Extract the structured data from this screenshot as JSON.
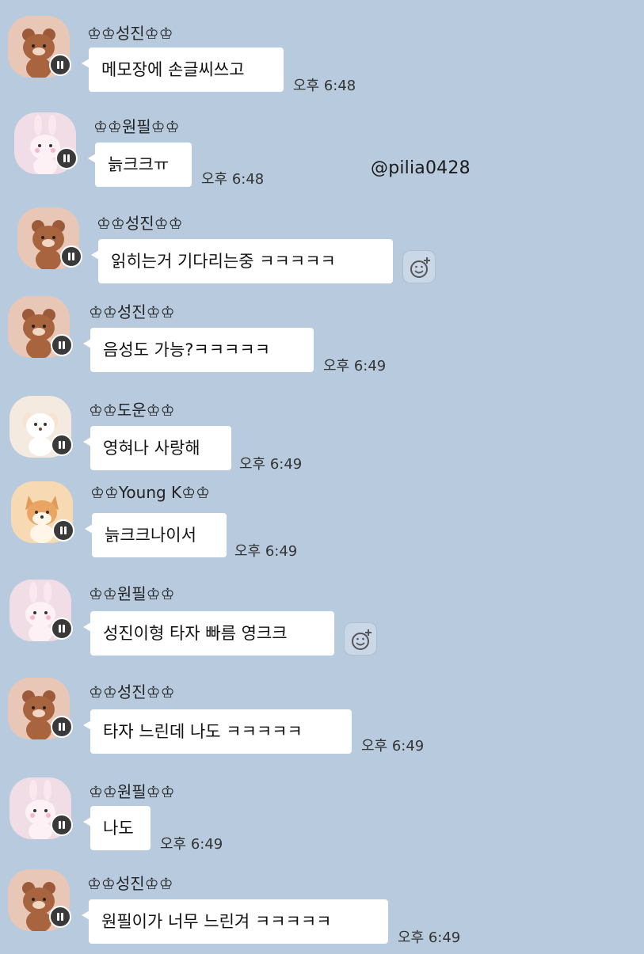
{
  "watermark": "@pilia0428",
  "colors": {
    "background": "#b8cadd",
    "bubble": "#ffffff"
  },
  "messages": [
    {
      "sender": "♔♔성진♔♔",
      "text": "메모장에 손글씨쓰고",
      "time": "오후 6:48",
      "avatar": "bear"
    },
    {
      "sender": "♔♔원필♔♔",
      "text": "늙크크ㅠ",
      "time": "오후 6:48",
      "avatar": "bunny"
    },
    {
      "sender": "♔♔성진♔♔",
      "text": "읽히는거 기다리는중 ㅋㅋㅋㅋㅋ",
      "time": "",
      "avatar": "bear",
      "reaction": "add-reaction-icon"
    },
    {
      "sender": "♔♔성진♔♔",
      "text": "음성도 가능?ㅋㅋㅋㅋㅋ",
      "time": "오후 6:49",
      "avatar": "bear"
    },
    {
      "sender": "♔♔도운♔♔",
      "text": "영혀나 사랑해",
      "time": "오후 6:49",
      "avatar": "puppy"
    },
    {
      "sender": "♔♔Young K♔♔",
      "text": "늙크크나이서",
      "time": "오후 6:49",
      "avatar": "fox"
    },
    {
      "sender": "♔♔원필♔♔",
      "text": "성진이형 타자 빠름 영크크",
      "time": "",
      "avatar": "bunny",
      "reaction": "add-reaction-icon"
    },
    {
      "sender": "♔♔성진♔♔",
      "text": "타자 느린데 나도 ㅋㅋㅋㅋㅋ",
      "time": "오후 6:49",
      "avatar": "bear"
    },
    {
      "sender": "♔♔원필♔♔",
      "text": "나도",
      "time": "오후 6:49",
      "avatar": "bunny"
    },
    {
      "sender": "♔♔성진♔♔",
      "text": "원필이가 너무 느린겨 ㅋㅋㅋㅋㅋ",
      "time": "오후 6:49",
      "avatar": "bear"
    }
  ]
}
